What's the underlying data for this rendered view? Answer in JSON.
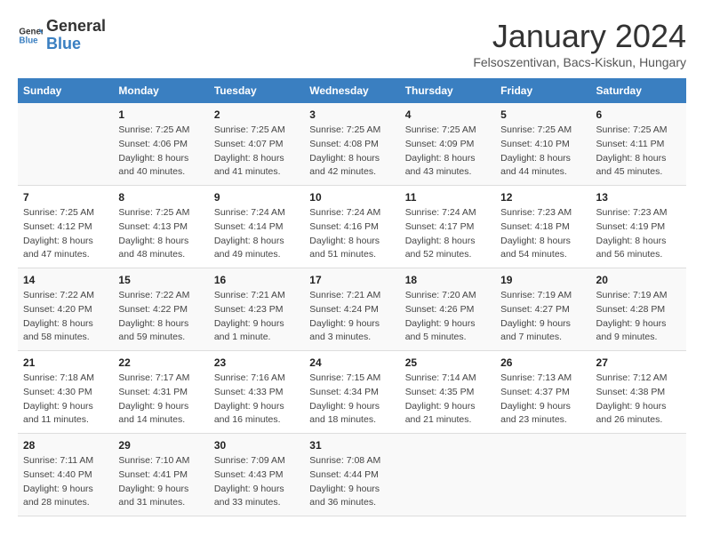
{
  "header": {
    "logo_general": "General",
    "logo_blue": "Blue",
    "title": "January 2024",
    "location": "Felsoszentivan, Bacs-Kiskun, Hungary"
  },
  "weekdays": [
    "Sunday",
    "Monday",
    "Tuesday",
    "Wednesday",
    "Thursday",
    "Friday",
    "Saturday"
  ],
  "weeks": [
    [
      {
        "day": "",
        "sunrise": "",
        "sunset": "",
        "daylight": ""
      },
      {
        "day": "1",
        "sunrise": "Sunrise: 7:25 AM",
        "sunset": "Sunset: 4:06 PM",
        "daylight": "Daylight: 8 hours and 40 minutes."
      },
      {
        "day": "2",
        "sunrise": "Sunrise: 7:25 AM",
        "sunset": "Sunset: 4:07 PM",
        "daylight": "Daylight: 8 hours and 41 minutes."
      },
      {
        "day": "3",
        "sunrise": "Sunrise: 7:25 AM",
        "sunset": "Sunset: 4:08 PM",
        "daylight": "Daylight: 8 hours and 42 minutes."
      },
      {
        "day": "4",
        "sunrise": "Sunrise: 7:25 AM",
        "sunset": "Sunset: 4:09 PM",
        "daylight": "Daylight: 8 hours and 43 minutes."
      },
      {
        "day": "5",
        "sunrise": "Sunrise: 7:25 AM",
        "sunset": "Sunset: 4:10 PM",
        "daylight": "Daylight: 8 hours and 44 minutes."
      },
      {
        "day": "6",
        "sunrise": "Sunrise: 7:25 AM",
        "sunset": "Sunset: 4:11 PM",
        "daylight": "Daylight: 8 hours and 45 minutes."
      }
    ],
    [
      {
        "day": "7",
        "sunrise": "Sunrise: 7:25 AM",
        "sunset": "Sunset: 4:12 PM",
        "daylight": "Daylight: 8 hours and 47 minutes."
      },
      {
        "day": "8",
        "sunrise": "Sunrise: 7:25 AM",
        "sunset": "Sunset: 4:13 PM",
        "daylight": "Daylight: 8 hours and 48 minutes."
      },
      {
        "day": "9",
        "sunrise": "Sunrise: 7:24 AM",
        "sunset": "Sunset: 4:14 PM",
        "daylight": "Daylight: 8 hours and 49 minutes."
      },
      {
        "day": "10",
        "sunrise": "Sunrise: 7:24 AM",
        "sunset": "Sunset: 4:16 PM",
        "daylight": "Daylight: 8 hours and 51 minutes."
      },
      {
        "day": "11",
        "sunrise": "Sunrise: 7:24 AM",
        "sunset": "Sunset: 4:17 PM",
        "daylight": "Daylight: 8 hours and 52 minutes."
      },
      {
        "day": "12",
        "sunrise": "Sunrise: 7:23 AM",
        "sunset": "Sunset: 4:18 PM",
        "daylight": "Daylight: 8 hours and 54 minutes."
      },
      {
        "day": "13",
        "sunrise": "Sunrise: 7:23 AM",
        "sunset": "Sunset: 4:19 PM",
        "daylight": "Daylight: 8 hours and 56 minutes."
      }
    ],
    [
      {
        "day": "14",
        "sunrise": "Sunrise: 7:22 AM",
        "sunset": "Sunset: 4:20 PM",
        "daylight": "Daylight: 8 hours and 58 minutes."
      },
      {
        "day": "15",
        "sunrise": "Sunrise: 7:22 AM",
        "sunset": "Sunset: 4:22 PM",
        "daylight": "Daylight: 8 hours and 59 minutes."
      },
      {
        "day": "16",
        "sunrise": "Sunrise: 7:21 AM",
        "sunset": "Sunset: 4:23 PM",
        "daylight": "Daylight: 9 hours and 1 minute."
      },
      {
        "day": "17",
        "sunrise": "Sunrise: 7:21 AM",
        "sunset": "Sunset: 4:24 PM",
        "daylight": "Daylight: 9 hours and 3 minutes."
      },
      {
        "day": "18",
        "sunrise": "Sunrise: 7:20 AM",
        "sunset": "Sunset: 4:26 PM",
        "daylight": "Daylight: 9 hours and 5 minutes."
      },
      {
        "day": "19",
        "sunrise": "Sunrise: 7:19 AM",
        "sunset": "Sunset: 4:27 PM",
        "daylight": "Daylight: 9 hours and 7 minutes."
      },
      {
        "day": "20",
        "sunrise": "Sunrise: 7:19 AM",
        "sunset": "Sunset: 4:28 PM",
        "daylight": "Daylight: 9 hours and 9 minutes."
      }
    ],
    [
      {
        "day": "21",
        "sunrise": "Sunrise: 7:18 AM",
        "sunset": "Sunset: 4:30 PM",
        "daylight": "Daylight: 9 hours and 11 minutes."
      },
      {
        "day": "22",
        "sunrise": "Sunrise: 7:17 AM",
        "sunset": "Sunset: 4:31 PM",
        "daylight": "Daylight: 9 hours and 14 minutes."
      },
      {
        "day": "23",
        "sunrise": "Sunrise: 7:16 AM",
        "sunset": "Sunset: 4:33 PM",
        "daylight": "Daylight: 9 hours and 16 minutes."
      },
      {
        "day": "24",
        "sunrise": "Sunrise: 7:15 AM",
        "sunset": "Sunset: 4:34 PM",
        "daylight": "Daylight: 9 hours and 18 minutes."
      },
      {
        "day": "25",
        "sunrise": "Sunrise: 7:14 AM",
        "sunset": "Sunset: 4:35 PM",
        "daylight": "Daylight: 9 hours and 21 minutes."
      },
      {
        "day": "26",
        "sunrise": "Sunrise: 7:13 AM",
        "sunset": "Sunset: 4:37 PM",
        "daylight": "Daylight: 9 hours and 23 minutes."
      },
      {
        "day": "27",
        "sunrise": "Sunrise: 7:12 AM",
        "sunset": "Sunset: 4:38 PM",
        "daylight": "Daylight: 9 hours and 26 minutes."
      }
    ],
    [
      {
        "day": "28",
        "sunrise": "Sunrise: 7:11 AM",
        "sunset": "Sunset: 4:40 PM",
        "daylight": "Daylight: 9 hours and 28 minutes."
      },
      {
        "day": "29",
        "sunrise": "Sunrise: 7:10 AM",
        "sunset": "Sunset: 4:41 PM",
        "daylight": "Daylight: 9 hours and 31 minutes."
      },
      {
        "day": "30",
        "sunrise": "Sunrise: 7:09 AM",
        "sunset": "Sunset: 4:43 PM",
        "daylight": "Daylight: 9 hours and 33 minutes."
      },
      {
        "day": "31",
        "sunrise": "Sunrise: 7:08 AM",
        "sunset": "Sunset: 4:44 PM",
        "daylight": "Daylight: 9 hours and 36 minutes."
      },
      {
        "day": "",
        "sunrise": "",
        "sunset": "",
        "daylight": ""
      },
      {
        "day": "",
        "sunrise": "",
        "sunset": "",
        "daylight": ""
      },
      {
        "day": "",
        "sunrise": "",
        "sunset": "",
        "daylight": ""
      }
    ]
  ]
}
